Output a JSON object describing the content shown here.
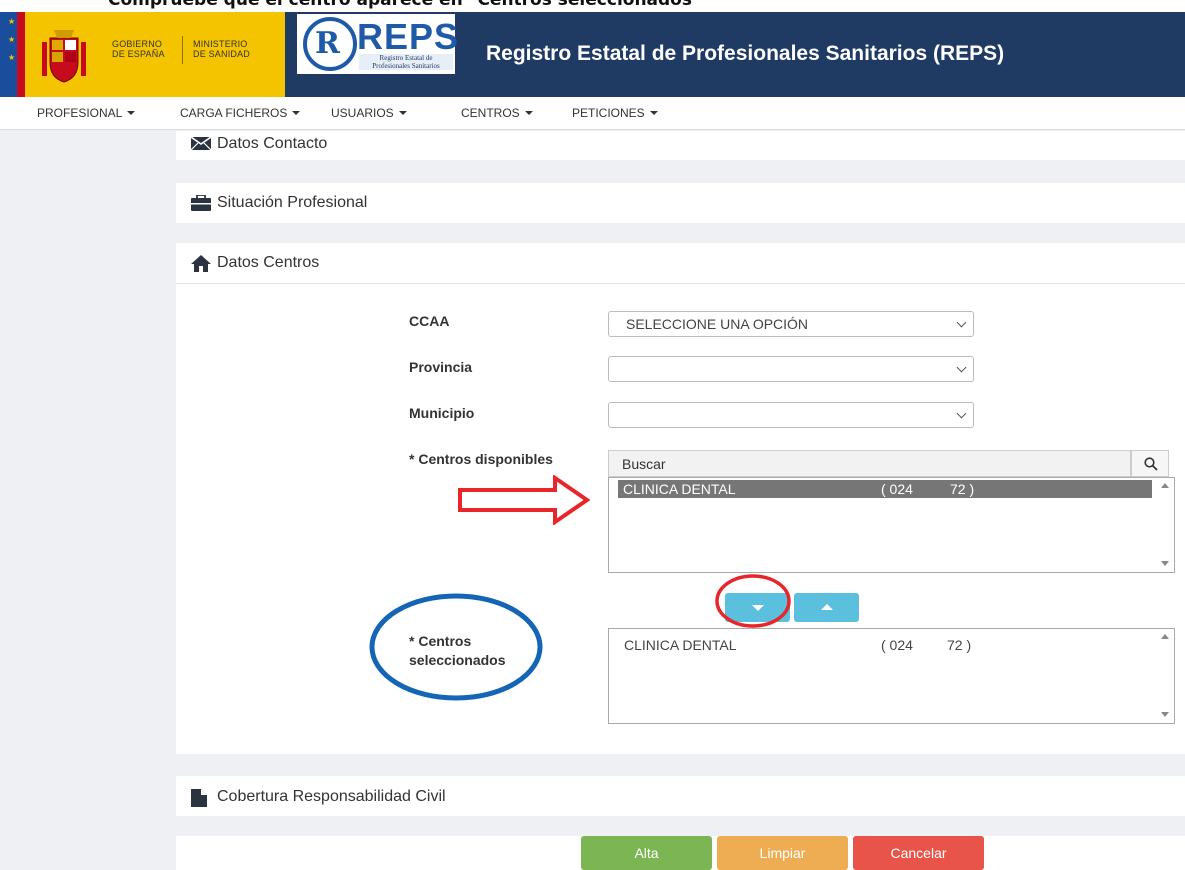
{
  "caption": "Compruebe que el centro aparece en \"Centros seleccionados\"",
  "header": {
    "gov_line1": "GOBIERNO",
    "gov_line2": "DE ESPAÑA",
    "ministry_line1": "MINISTERIO",
    "ministry_line2": "DE SANIDAD",
    "logo_word": "REPS",
    "logo_sub1": "Registro Estatal de",
    "logo_sub2": "Profesionales Sanitarios",
    "title": "Registro Estatal de Profesionales Sanitarios (REPS)"
  },
  "nav": {
    "items": [
      {
        "label": "PROFESIONAL"
      },
      {
        "label": "CARGA FICHEROS"
      },
      {
        "label": "USUARIOS"
      },
      {
        "label": "CENTROS"
      },
      {
        "label": "PETICIONES"
      }
    ]
  },
  "sections": {
    "contacto": "Datos Contacto",
    "situacion": "Situación Profesional",
    "centros": "Datos Centros",
    "cobertura": "Cobertura Responsabilidad Civil"
  },
  "form": {
    "ccaa_label": "CCAA",
    "ccaa_value": "SELECCIONE UNA OPCIÓN",
    "provincia_label": "Provincia",
    "provincia_value": "",
    "municipio_label": "Municipio",
    "municipio_value": "",
    "disponibles_label": "* Centros disponibles",
    "search_value": "Buscar",
    "disponibles_items": [
      {
        "name": "CLINICA DENTAL",
        "code_a": "( 024",
        "code_b": "72 )"
      }
    ],
    "seleccionados_label_1": "* Centros",
    "seleccionados_label_2": "seleccionados",
    "seleccionados_items": [
      {
        "name": "CLINICA DENTAL",
        "code_a": "( 024",
        "code_b": "72 )"
      }
    ]
  },
  "actions": {
    "alta": "Alta",
    "limpiar": "Limpiar",
    "cancelar": "Cancelar"
  },
  "colors": {
    "header_bg": "#1f3a63",
    "gov_yellow": "#f5c400",
    "move_button": "#5bc0de",
    "alta": "#7cb554",
    "limpiar": "#eead52",
    "cancelar": "#e8544a",
    "annotation_red": "#e8262a",
    "annotation_blue": "#1565b7"
  }
}
